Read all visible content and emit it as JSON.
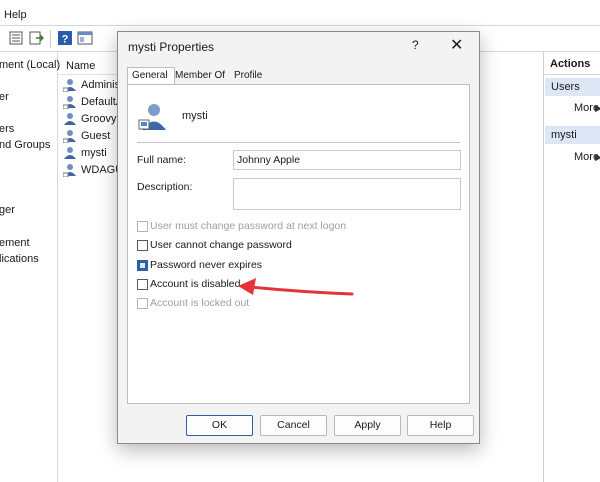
{
  "menubar": {
    "help_label": "Help"
  },
  "tree": {
    "items": [
      "ment (Local)",
      "er",
      "ers",
      "nd Groups",
      "ger",
      "ement",
      "lications"
    ]
  },
  "list": {
    "column_name": "Name",
    "users": [
      "Adminis",
      "DefaultA",
      "Groovy",
      "Guest",
      "mysti",
      "WDAGU"
    ]
  },
  "actions": {
    "title": "Actions",
    "section1": "Users",
    "section1_more": "More",
    "section2": "mysti",
    "section2_more": "More"
  },
  "dialog": {
    "title": "mysti Properties",
    "help_glyph": "?",
    "close_glyph": "✕",
    "tabs": [
      "General",
      "Member Of",
      "Profile"
    ],
    "active_tab": "General",
    "username": "mysti",
    "full_name_label": "Full name:",
    "full_name_value": "Johnny Apple",
    "description_label": "Description:",
    "description_value": "",
    "checkboxes": [
      {
        "label": "User must change password at next logon",
        "checked": false,
        "enabled": false
      },
      {
        "label": "User cannot change password",
        "checked": false,
        "enabled": true
      },
      {
        "label": "Password never expires",
        "checked": true,
        "enabled": true
      },
      {
        "label": "Account is disabled",
        "checked": false,
        "enabled": true
      },
      {
        "label": "Account is locked out",
        "checked": false,
        "enabled": false
      }
    ],
    "buttons": {
      "ok": "OK",
      "cancel": "Cancel",
      "apply": "Apply",
      "help": "Help"
    }
  },
  "icons": {
    "toolbar": [
      "properties-icon",
      "export-icon",
      "help-icon",
      "view-icon"
    ],
    "user": "user-icon",
    "close": "close-icon"
  },
  "colors": {
    "annotation_arrow": "#e5333a",
    "selection": "#dce6f4",
    "checkbox_checked": "#2e5fa8"
  }
}
